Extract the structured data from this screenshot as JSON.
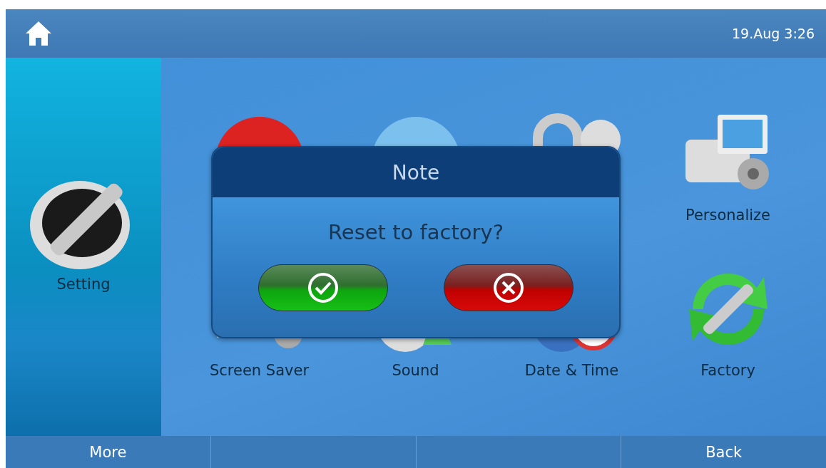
{
  "status_bar": {
    "date_time": "19.Aug 3:26"
  },
  "sidebar": {
    "label": "Setting"
  },
  "apps": [
    {
      "kind": "account"
    },
    {
      "kind": "wan"
    },
    {
      "kind": "lock"
    },
    {
      "kind": "phone",
      "label": "Personalize"
    },
    {
      "kind": "monitor",
      "label": "Screen Saver"
    },
    {
      "kind": "sound",
      "label": "Sound"
    },
    {
      "kind": "clock",
      "label": "Date & Time"
    },
    {
      "kind": "factory",
      "label": "Factory"
    }
  ],
  "dialog": {
    "title": "Note",
    "message": "Reset to factory?",
    "buttons": [
      {
        "kind": "confirm"
      },
      {
        "kind": "cancel"
      }
    ]
  },
  "softkeys": [
    {
      "kind": "label",
      "label": "More"
    },
    {
      "kind": "blank"
    },
    {
      "kind": "blank"
    },
    {
      "kind": "label",
      "label": "Back"
    }
  ]
}
